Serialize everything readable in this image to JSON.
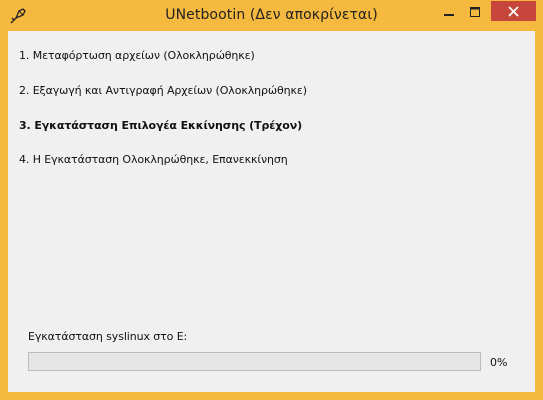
{
  "window": {
    "title": "UNetbootin (Δεν αποκρίνεται)",
    "frame_color": "#f6b93f",
    "close_color": "#c7463b"
  },
  "titlebar_buttons": {
    "minimize_icon": "minimize-icon",
    "maximize_icon": "maximize-icon",
    "close_icon": "close-icon"
  },
  "steps": [
    {
      "label": "1. Μεταφόρτωση αρχείων (Ολοκληρώθηκε)",
      "current": false
    },
    {
      "label": "2. Εξαγωγή και Αντιγραφή Αρχείων (Ολοκληρώθηκε)",
      "current": false
    },
    {
      "label": "3. Εγκατάσταση Επιλογέα Εκκίνησης (Τρέχον)",
      "current": true
    },
    {
      "label": "4. Η Εγκατάσταση Ολοκληρώθηκε, Επανεκκίνηση",
      "current": false
    }
  ],
  "status": {
    "label": "Εγκατάσταση syslinux στο E:",
    "progress_text": "0%",
    "progress_value": 0
  }
}
